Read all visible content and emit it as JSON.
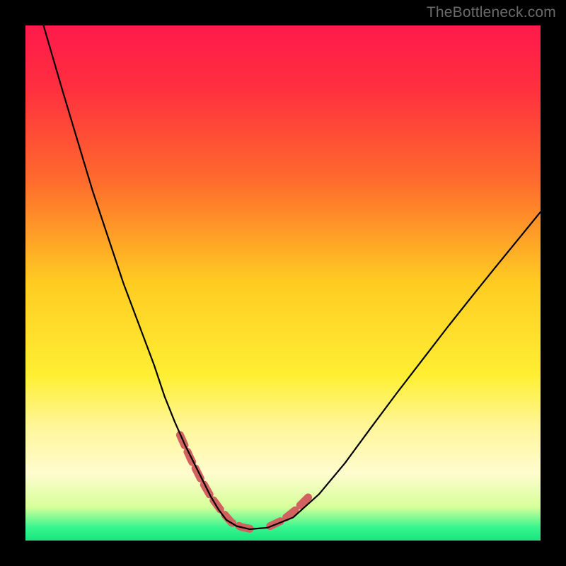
{
  "watermark": "TheBottleneck.com",
  "chart_data": {
    "type": "line",
    "title": "",
    "xlabel": "",
    "ylabel": "",
    "xlim": [
      0,
      1
    ],
    "ylim": [
      0,
      1
    ],
    "gradient_stops": [
      {
        "offset": 0.0,
        "color": "#ff1a4b"
      },
      {
        "offset": 0.12,
        "color": "#ff2f3f"
      },
      {
        "offset": 0.3,
        "color": "#ff6a2d"
      },
      {
        "offset": 0.5,
        "color": "#ffcc22"
      },
      {
        "offset": 0.68,
        "color": "#ffef33"
      },
      {
        "offset": 0.78,
        "color": "#fff69a"
      },
      {
        "offset": 0.87,
        "color": "#fffccf"
      },
      {
        "offset": 0.935,
        "color": "#d6ff9a"
      },
      {
        "offset": 0.975,
        "color": "#36f58e"
      },
      {
        "offset": 1.0,
        "color": "#19e57e"
      }
    ],
    "series": [
      {
        "name": "curve",
        "stroke": "#000000",
        "stroke_width": 2.2,
        "x": [
          0.035,
          0.07,
          0.1,
          0.13,
          0.16,
          0.19,
          0.22,
          0.25,
          0.27,
          0.29,
          0.31,
          0.33,
          0.345,
          0.36,
          0.375,
          0.39,
          0.41,
          0.435,
          0.47,
          0.52,
          0.57,
          0.62,
          0.67,
          0.72,
          0.77,
          0.82,
          0.87,
          0.92,
          0.965,
          1.0
        ],
        "y": [
          1.0,
          0.88,
          0.78,
          0.68,
          0.59,
          0.5,
          0.42,
          0.34,
          0.28,
          0.23,
          0.185,
          0.145,
          0.115,
          0.085,
          0.06,
          0.04,
          0.028,
          0.022,
          0.025,
          0.045,
          0.09,
          0.15,
          0.218,
          0.285,
          0.35,
          0.415,
          0.478,
          0.54,
          0.595,
          0.638
        ]
      },
      {
        "name": "highlight",
        "stroke": "#d1625f",
        "stroke_width": 11,
        "segments": [
          {
            "x": [
              0.3,
              0.32,
              0.34,
              0.36,
              0.38,
              0.4,
              0.42,
              0.44
            ],
            "y": [
              0.205,
              0.16,
              0.12,
              0.085,
              0.058,
              0.035,
              0.026,
              0.022
            ]
          },
          {
            "x": [
              0.475,
              0.5,
              0.525,
              0.55
            ],
            "y": [
              0.028,
              0.04,
              0.06,
              0.085
            ]
          }
        ]
      }
    ]
  }
}
